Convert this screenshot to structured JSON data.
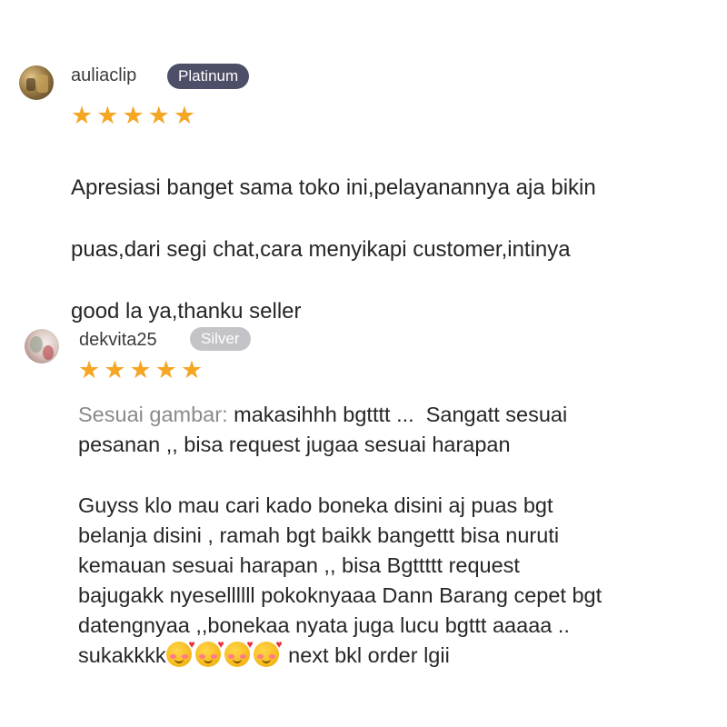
{
  "reviews": [
    {
      "username": "auliaclip",
      "badge": "Platinum",
      "rating_stars": 5,
      "avatar_icon": "user-avatar",
      "lines": [
        "Apresiasi banget sama toko ini,pelayanannya aja bikin",
        "puas,dari segi chat,cara menyikapi customer,intinya",
        "good la ya,thanku seller"
      ]
    },
    {
      "username": "dekvita25",
      "badge": "Silver",
      "rating_stars": 5,
      "avatar_icon": "user-avatar",
      "label": "Sesuai gambar:",
      "block1_lines": [
        " makasihhh bgtttt ...  Sangatt sesuai",
        "pesanan ,, bisa request jugaa sesuai harapan"
      ],
      "block2_lines": [
        "Guyss klo mau cari kado boneka disini aj puas bgt",
        "belanja disini , ramah bgt baikk bangettt bisa nuruti",
        "kemauan sesuai harapan ,, bisa Bgttttt request",
        "bajugakk nyesellllll pokoknyaaa Dann Barang cepet bgt",
        "datengnyaa ,,bonekaa nyata juga lucu bgttt aaaaa ..",
        "sukakkkk"
      ],
      "emoji_icon": "smiling-face-with-hearts-emoji",
      "emoji_count": 4,
      "tail_text": " next bkl order lgii"
    }
  ],
  "colors": {
    "star": "#f5a623",
    "platinum_badge": "#4d4e68",
    "silver_badge": "#c3c3c8",
    "label_grey": "#8a8a8a"
  }
}
